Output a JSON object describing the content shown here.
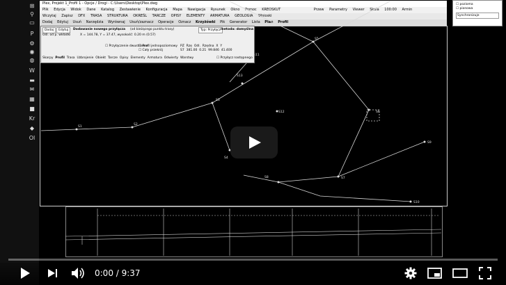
{
  "app": {
    "title": "Plex, Projekt 1_Profil 1 - Opcje / Drogi - C:\\Users\\Desktop\\Plex.dwg",
    "menus": [
      "Plik",
      "Edycja",
      "Widok",
      "Dane",
      "Katalog",
      "Zestawienie",
      "Konfiguracja",
      "Mapa",
      "Nawigacja",
      "Rysunek",
      "Okno",
      "Pomoc",
      "KREOSKUT"
    ],
    "toolbar": [
      "Wczytaj",
      "Zapisz",
      "DFX",
      "TRASA",
      "STRUKTURA",
      "OKREŚL",
      "TARCZE",
      "OPISY",
      "ELEMENTY",
      "ARMATURA",
      "GEOLOGIA",
      "Wnioski"
    ],
    "toolbar_right": [
      "Przew",
      "Parametry",
      "Viewer",
      "Skala",
      "100:00",
      "Armin"
    ],
    "ribbon_tabs": [
      "Dodaj",
      "Edytuj",
      "Usuń",
      "Narzędzia",
      "Wyrównaj",
      "Usuń/zaznacz",
      "Operacje",
      "Oznacz",
      "Krzyżówki",
      "Pik",
      "Generator",
      "Lista",
      "Plan",
      "Profil"
    ],
    "side_panel": [
      "pozioma",
      "pionowa",
      "Synchronizuje"
    ]
  },
  "dialog": {
    "buttons": [
      "Dodaj",
      "Edytuj"
    ],
    "heading": "Dodawanie nowego przyłącza",
    "subheading": "(od bieżącego punktu trasy)",
    "field_label": "Odl. od p. wkładki",
    "field_hint": "X = 144.78, Y = 37.47, wysokość: 0.20 m (0.57)",
    "type_label": "Typ: Przyłącz",
    "mode_label": "metoda: domyślna",
    "checkbox_1": "Przyłączenie dwustronne",
    "checkbox_2": "Profil jednopoziomowy",
    "checkbox_3": "Cały przekrój",
    "columns": [
      "PZ",
      "Rzę",
      "Odl.",
      "Rzędna",
      "X",
      "Y"
    ],
    "row": [
      "S7",
      "381.00",
      "0.21",
      "99.846",
      "41.400"
    ],
    "tabs": [
      "Skarpy",
      "Profil",
      "Trasa",
      "Uzbrojenie",
      "Obiekt",
      "Tarcze",
      "Opisy",
      "Elementy",
      "Armatura",
      "Odwierty",
      "Warstwy"
    ],
    "extra_checkbox": "Przyłącz następnego"
  },
  "drawing": {
    "labels": [
      "S1",
      "S2",
      "S3",
      "S4",
      "S5",
      "S6",
      "S7",
      "S8",
      "S9",
      "S10",
      "S11",
      "S12",
      "S13"
    ]
  },
  "player": {
    "current_time": "0:00",
    "duration": "9:37",
    "time_text": "0:00 / 9:37",
    "progress": 0.0,
    "volume_level": 1.0,
    "play_overlay_label": "Play",
    "accent": "#ff0000"
  },
  "taskbar": {
    "items": [
      "P",
      "W",
      "Kr",
      "Ol"
    ]
  },
  "colors": {
    "canvas": "#000000",
    "line": "#d8d8d8",
    "dialog_bg": "#efefef"
  }
}
